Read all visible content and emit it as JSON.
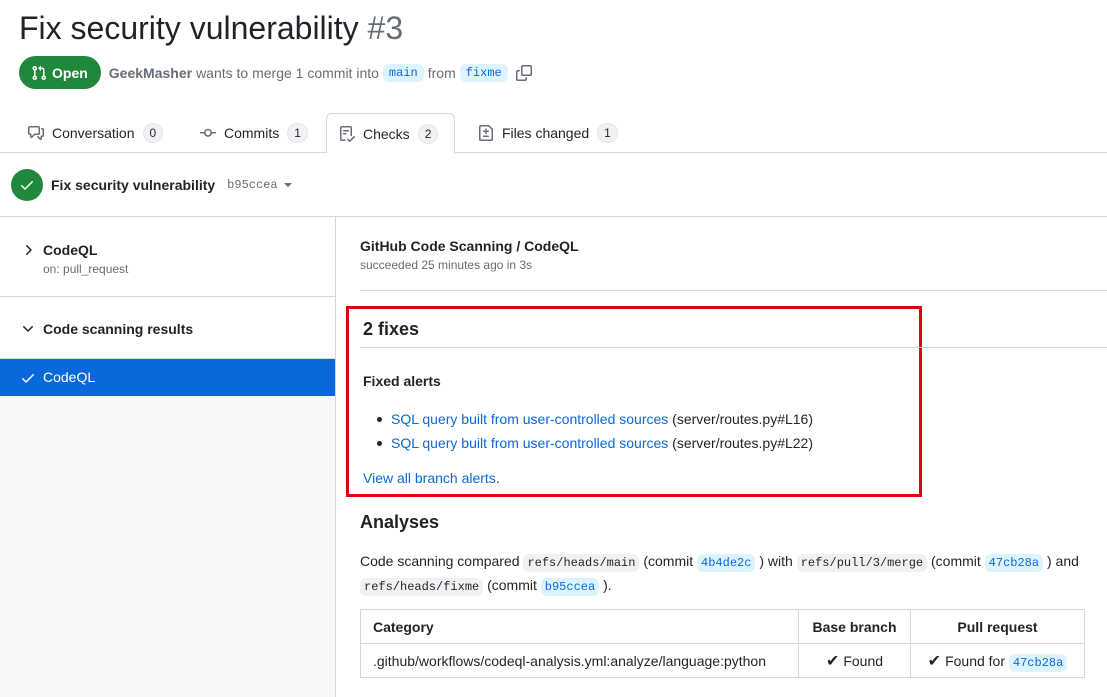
{
  "pr": {
    "title": "Fix security vulnerability",
    "number": "#3",
    "state": "Open",
    "author": "GeekMasher",
    "merge_text": "wants to merge 1 commit into",
    "base_branch": "main",
    "from_text": "from",
    "head_branch": "fixme"
  },
  "tabs": [
    {
      "label": "Conversation",
      "count": "0"
    },
    {
      "label": "Commits",
      "count": "1"
    },
    {
      "label": "Checks",
      "count": "2"
    },
    {
      "label": "Files changed",
      "count": "1"
    }
  ],
  "checks_header": {
    "title": "Fix security vulnerability",
    "sha": "b95ccea"
  },
  "sidebar": {
    "run_name": "CodeQL",
    "run_trigger": "on: pull_request",
    "suite_name": "Code scanning results",
    "active_item": "CodeQL"
  },
  "main": {
    "run_title": "GitHub Code Scanning / CodeQL",
    "run_status": "succeeded 25 minutes ago in 3s",
    "fixes_title": "2 fixes",
    "fixed_alerts_heading": "Fixed alerts",
    "alerts": [
      {
        "link": "SQL query built from user-controlled sources",
        "location": "(server/routes.py#L16)"
      },
      {
        "link": "SQL query built from user-controlled sources",
        "location": "(server/routes.py#L22)"
      }
    ],
    "view_all_link": "View all branch alerts",
    "view_all_suffix": ".",
    "analyses_title": "Analyses",
    "analysis": {
      "t1": "Code scanning compared",
      "base_ref": "refs/heads/main",
      "t2": "(commit",
      "base_commit": "4b4de2c",
      "t3": ") with",
      "merge_ref": "refs/pull/3/merge",
      "t4": "(commit",
      "merge_commit": "47cb28a",
      "t5": ") and",
      "head_ref": "refs/heads/fixme",
      "t6": "(commit",
      "head_commit": "b95ccea",
      "t7": ")."
    },
    "table": {
      "headers": [
        "Category",
        "Base branch",
        "Pull request"
      ],
      "row": {
        "category": ".github/workflows/codeql-analysis.yml:analyze/language:python",
        "base_status": "Found",
        "pr_status": "Found for",
        "pr_commit": "47cb28a"
      }
    }
  }
}
